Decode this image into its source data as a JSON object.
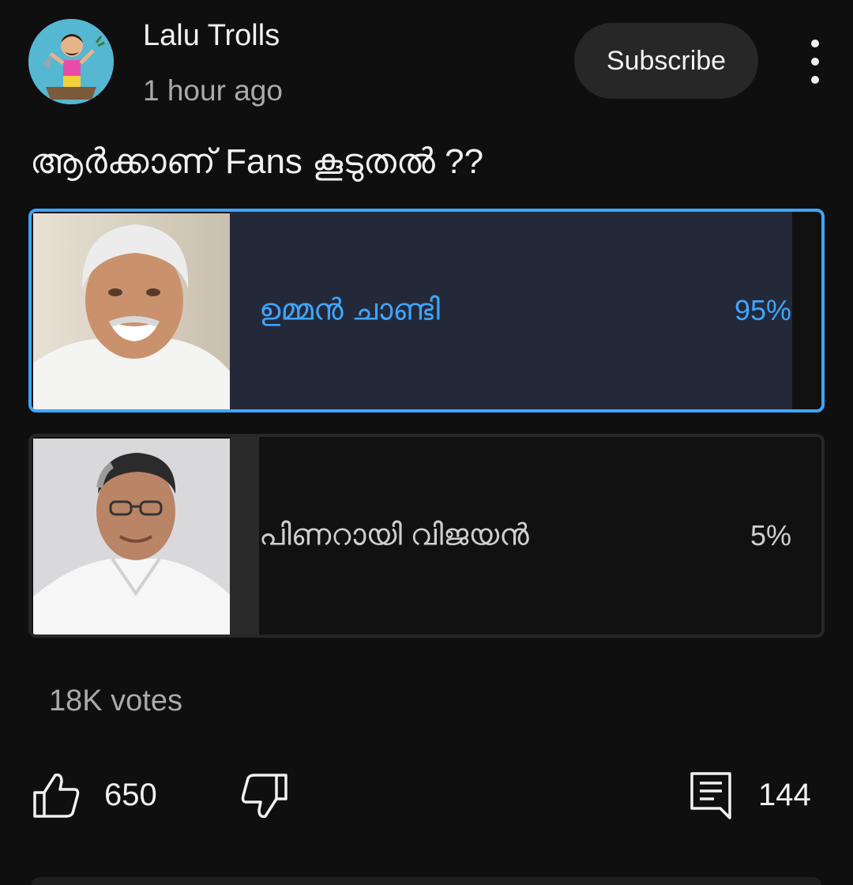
{
  "post": {
    "channel_name": "Lalu Trolls",
    "timestamp": "1 hour ago",
    "subscribe_label": "Subscribe",
    "text": "ആർക്കാണ് Fans കൂടുതൽ ??"
  },
  "poll": {
    "options": [
      {
        "label": "ഉമ്മൻ ചാണ്ടി",
        "percent_label": "95%",
        "percent": 95,
        "selected": true
      },
      {
        "label": "പിണറായി വിജയൻ",
        "percent_label": "5%",
        "percent": 5,
        "selected": false
      }
    ],
    "votes_label": "18K votes"
  },
  "actions": {
    "like_count": "650",
    "comment_count": "144",
    "icons": {
      "like": "thumbs-up-icon",
      "dislike": "thumbs-down-icon",
      "comment": "comment-icon",
      "more": "more-vert-icon"
    }
  },
  "colors": {
    "accent": "#3ea6ff",
    "background": "#0f0f0f",
    "selected_bar": "#24293a",
    "unselected_bar": "#2a2a2a"
  }
}
